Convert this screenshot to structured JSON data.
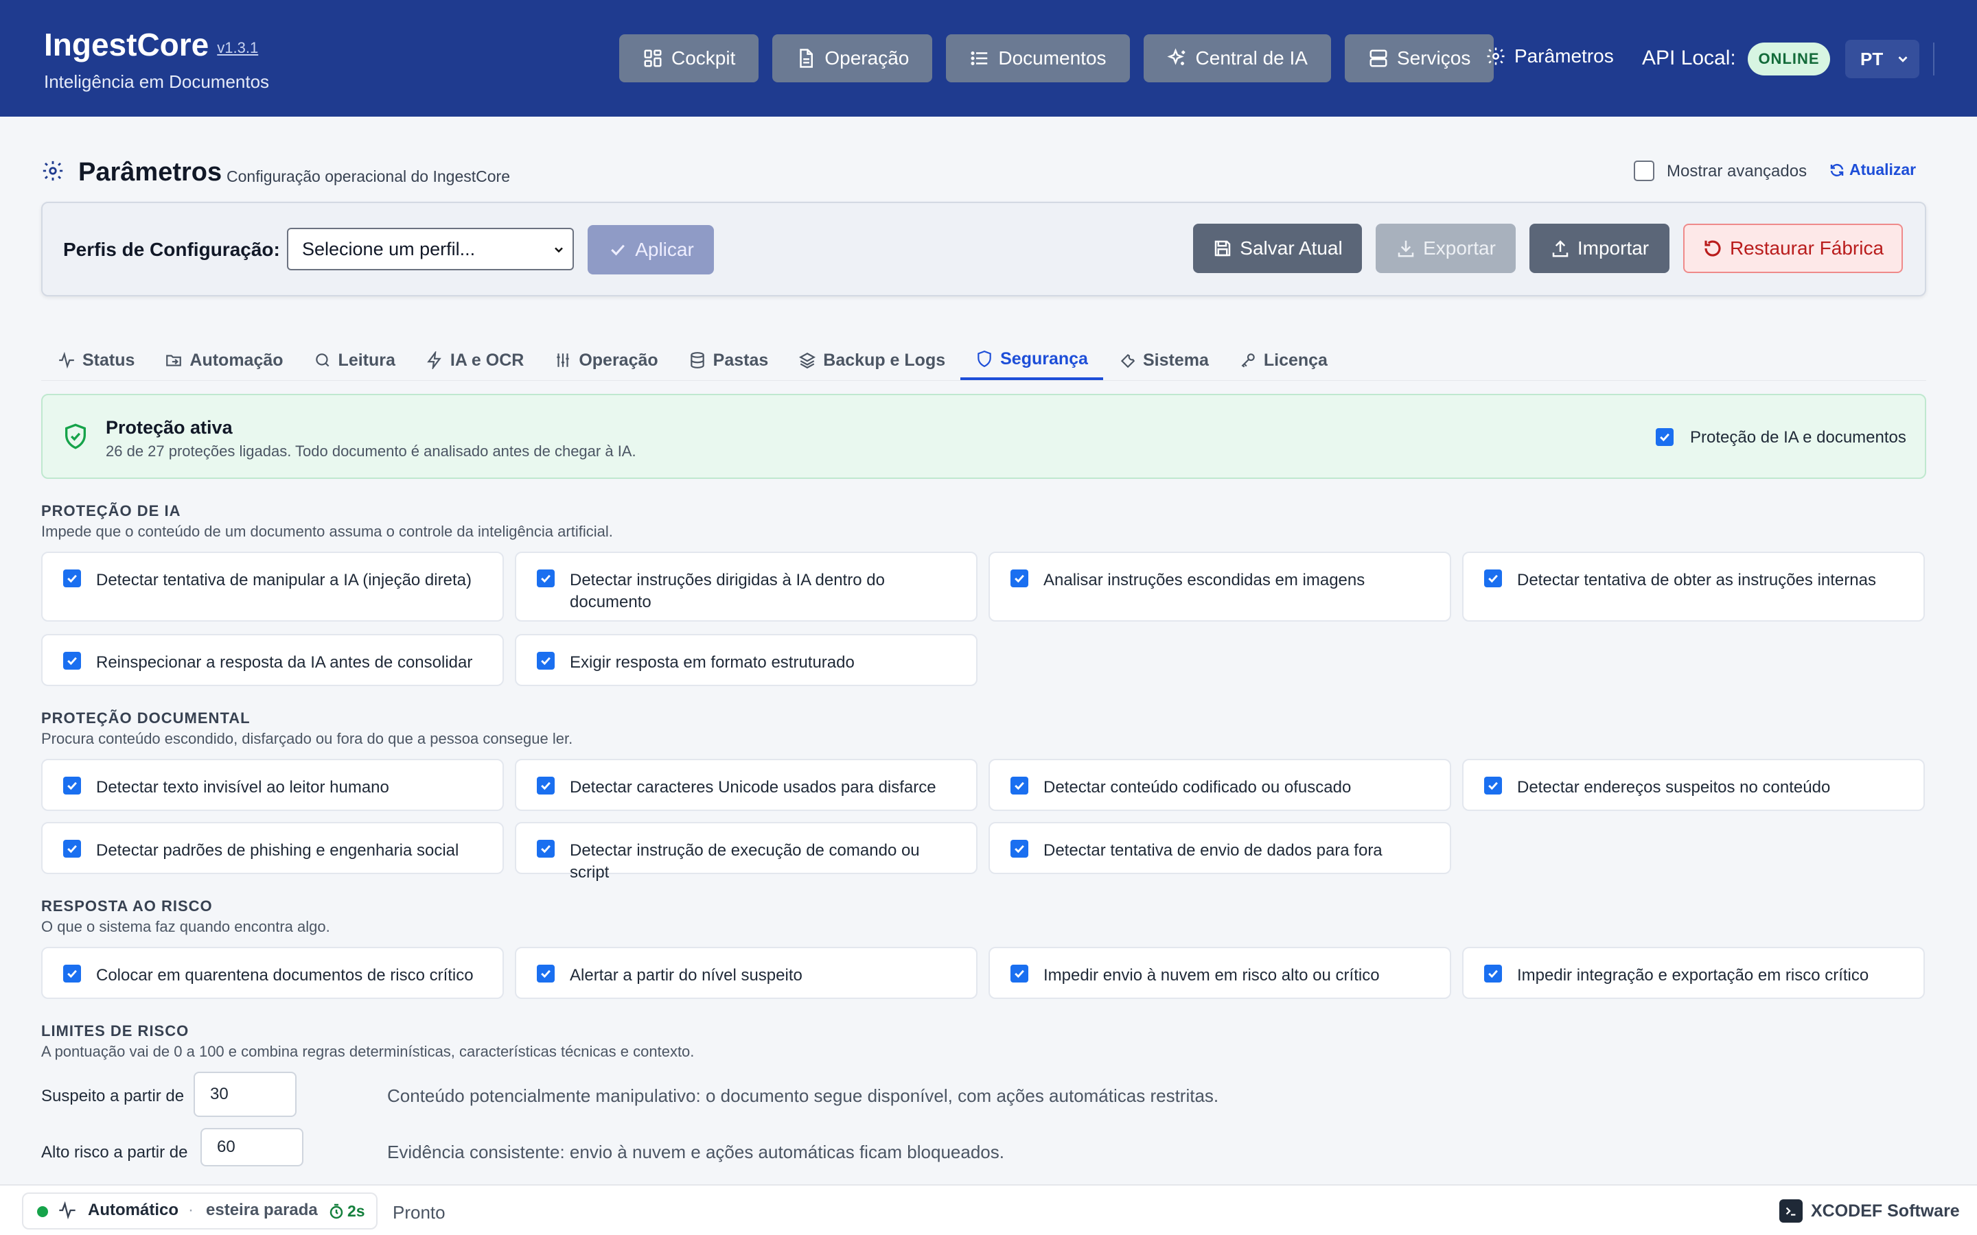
{
  "header": {
    "brand_name": "IngestCore",
    "version": "v1.3.1",
    "subtitle": "Inteligência em Documentos",
    "nav": [
      {
        "label": "Cockpit",
        "icon": "grid-icon"
      },
      {
        "label": "Operação",
        "icon": "document-icon"
      },
      {
        "label": "Documentos",
        "icon": "list-icon"
      },
      {
        "label": "Central de IA",
        "icon": "sparkles-icon"
      },
      {
        "label": "Serviços",
        "icon": "server-icon"
      }
    ],
    "params_label": "Parâmetros",
    "api_label": "API Local:",
    "api_status": "ONLINE",
    "language": "PT",
    "colors": {
      "bar": "#1f3b8f",
      "online_bg": "#d7f5e2",
      "online_text": "#136b3a"
    }
  },
  "page": {
    "title": "Parâmetros",
    "subtitle": "Configuração operacional do IngestCore",
    "show_advanced_label": "Mostrar avançados",
    "show_advanced_checked": false,
    "refresh_label": "Atualizar"
  },
  "profiles": {
    "label": "Perfis de Configuração:",
    "select_value": "Selecione um perfil...",
    "apply": "Aplicar",
    "save": "Salvar Atual",
    "export": "Exportar",
    "import": "Importar",
    "restore": "Restaurar Fábrica"
  },
  "tabs": [
    {
      "label": "Status",
      "icon": "pulse-icon",
      "active": false
    },
    {
      "label": "Automação",
      "icon": "folder-arrow-icon",
      "active": false
    },
    {
      "label": "Leitura",
      "icon": "search-icon",
      "active": false
    },
    {
      "label": "IA e OCR",
      "icon": "bolt-icon",
      "active": false
    },
    {
      "label": "Operação",
      "icon": "sliders-icon",
      "active": false
    },
    {
      "label": "Pastas",
      "icon": "database-icon",
      "active": false
    },
    {
      "label": "Backup e Logs",
      "icon": "layers-icon",
      "active": false
    },
    {
      "label": "Segurança",
      "icon": "shield-icon",
      "active": true
    },
    {
      "label": "Sistema",
      "icon": "wrench-icon",
      "active": false
    },
    {
      "label": "Licença",
      "icon": "key-icon",
      "active": false
    }
  ],
  "banner": {
    "title": "Proteção ativa",
    "subtitle": "26 de 27 proteções ligadas. Todo documento é analisado antes de chegar à IA.",
    "toggle_label": "Proteção de IA e documentos",
    "toggle_checked": true
  },
  "sections": {
    "ai": {
      "title": "PROTEÇÃO DE IA",
      "desc": "Impede que o conteúdo de um documento assuma o controle da inteligência artificial.",
      "items": [
        "Detectar tentativa de manipular a IA (injeção direta)",
        "Detectar instruções dirigidas à IA dentro do documento",
        "Analisar instruções escondidas em imagens",
        "Detectar tentativa de obter as instruções internas",
        "Reinspecionar a resposta da IA antes de consolidar",
        "Exigir resposta em formato estruturado"
      ]
    },
    "doc": {
      "title": "PROTEÇÃO DOCUMENTAL",
      "desc": "Procura conteúdo escondido, disfarçado ou fora do que a pessoa consegue ler.",
      "items": [
        "Detectar texto invisível ao leitor humano",
        "Detectar caracteres Unicode usados para disfarce",
        "Detectar conteúdo codificado ou ofuscado",
        "Detectar endereços suspeitos no conteúdo",
        "Detectar padrões de phishing e engenharia social",
        "Detectar instrução de execução de comando ou script",
        "Detectar tentativa de envio de dados para fora"
      ]
    },
    "risk": {
      "title": "RESPOSTA AO RISCO",
      "desc": "O que o sistema faz quando encontra algo.",
      "items": [
        "Colocar em quarentena documentos de risco crítico",
        "Alertar a partir do nível suspeito",
        "Impedir envio à nuvem em risco alto ou crítico",
        "Impedir integração e exportação em risco crítico"
      ]
    },
    "limits": {
      "title": "LIMITES DE RISCO",
      "desc": "A pontuação vai de 0 a 100 e combina regras determinísticas, características técnicas e contexto.",
      "suspect_label": "Suspeito a partir de",
      "suspect_value": "30",
      "suspect_desc": "Conteúdo potencialmente manipulativo: o documento segue disponível, com ações automáticas restritas.",
      "high_label": "Alto risco a partir de",
      "high_value": "60",
      "high_desc": "Evidência consistente: envio à nuvem e ações automáticas ficam bloqueados."
    }
  },
  "statusbar": {
    "mode": "Automático",
    "separator": "·",
    "belt": "esteira parada",
    "timer": "2s",
    "ready": "Pronto",
    "brand": "XCODEF Software"
  }
}
